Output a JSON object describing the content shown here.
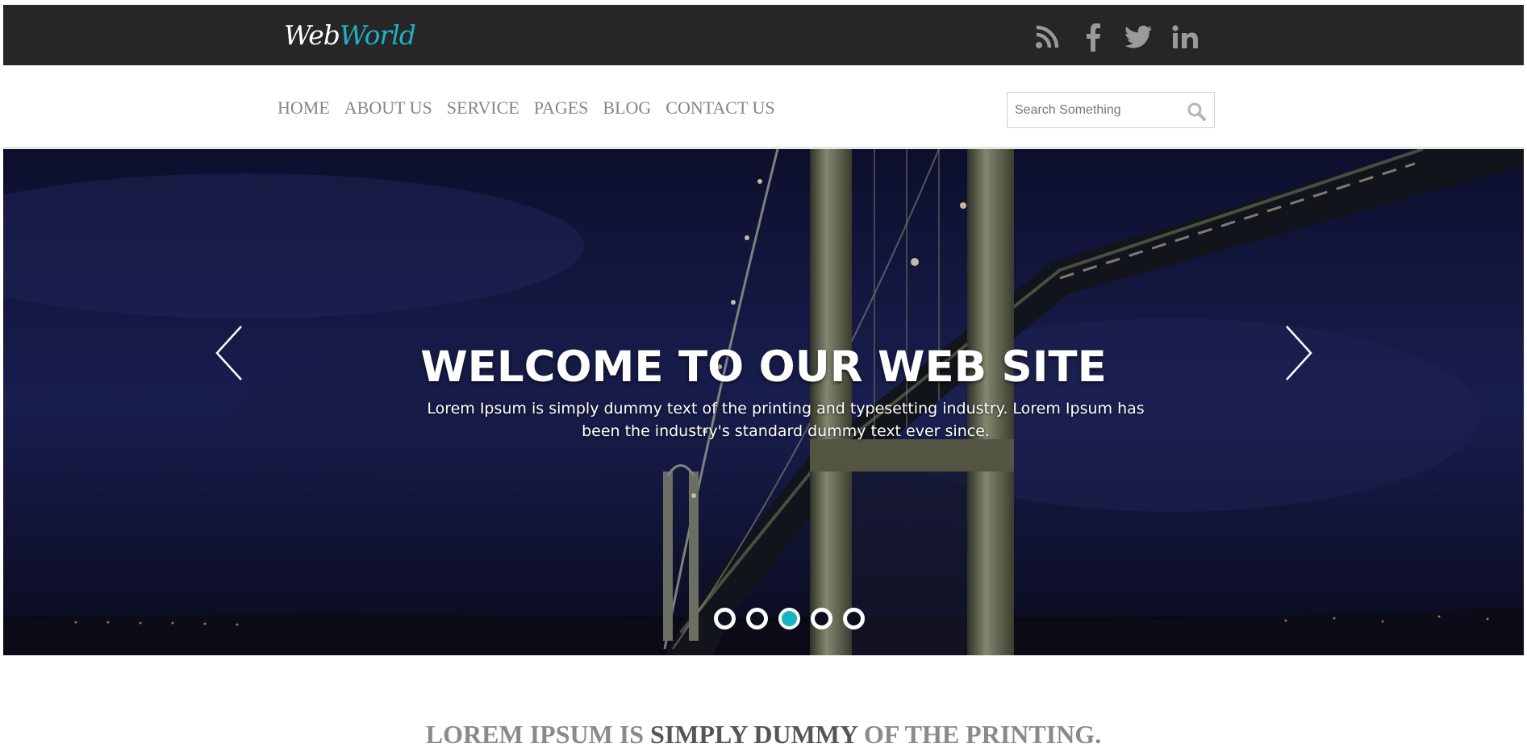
{
  "header": {
    "logo": {
      "part1": "Web",
      "part2": "World"
    },
    "social": [
      {
        "name": "rss-icon"
      },
      {
        "name": "facebook-icon"
      },
      {
        "name": "twitter-icon"
      },
      {
        "name": "linkedin-icon"
      }
    ]
  },
  "nav": {
    "items": [
      "HOME",
      "ABOUT US",
      "SERVICE",
      "PAGES",
      "BLOG",
      "CONTACT US"
    ],
    "search_placeholder": "Search Something"
  },
  "hero": {
    "title": "WELCOME TO OUR WEB SITE",
    "text": "Lorem Ipsum is simply dummy text of the printing and typesetting industry. Lorem Ipsum has been the industry's standard dummy text ever since.",
    "slides_total": 5,
    "active_slide": 3
  },
  "headline": {
    "part1": "LOREM IPSUM IS ",
    "part2": "SIMPLY DUMMY",
    "part3": " OF THE PRINTING."
  },
  "colors": {
    "accent": "#1bb3c3",
    "topbar": "#272525",
    "nav_text": "#858585"
  }
}
